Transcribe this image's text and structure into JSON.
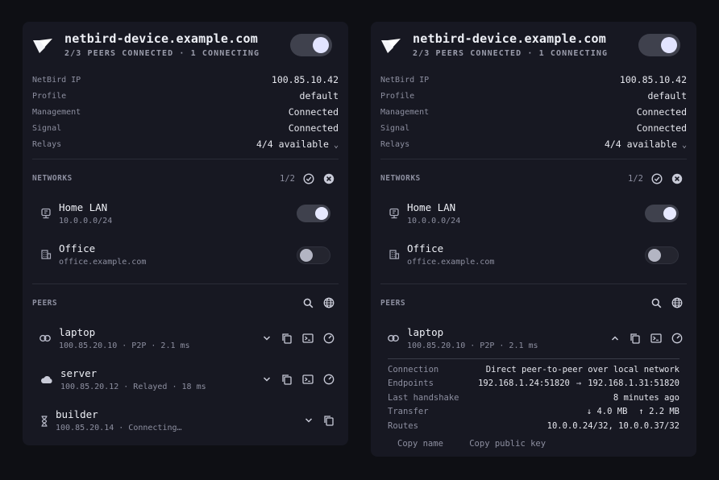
{
  "panels": [
    {
      "title": "netbird-device.example.com",
      "subtitle": "2/3 PEERS CONNECTED · 1 CONNECTING",
      "info": [
        {
          "label": "NetBird IP",
          "value": "100.85.10.42"
        },
        {
          "label": "Profile",
          "value": "default"
        },
        {
          "label": "Management",
          "value": "Connected"
        },
        {
          "label": "Signal",
          "value": "Connected"
        },
        {
          "label": "Relays",
          "value": "4/4 available"
        }
      ],
      "networks_title": "NETWORKS",
      "networks_count": "1/2",
      "networks": [
        {
          "name": "Home LAN",
          "sub": "10.0.0.0/24",
          "enabled": true,
          "icon": "router-icon"
        },
        {
          "name": "Office",
          "sub": "office.example.com",
          "enabled": false,
          "icon": "building-icon"
        }
      ],
      "peers_title": "PEERS",
      "peers": [
        {
          "name": "laptop",
          "sub": "100.85.20.10 · P2P · 2.1 ms",
          "icon": "link-icon"
        },
        {
          "name": "server",
          "sub": "100.85.20.12 · Relayed · 18 ms",
          "icon": "cloud-icon"
        },
        {
          "name": "builder",
          "sub": "100.85.20.14 · Connecting…",
          "icon": "hourglass-icon"
        }
      ]
    },
    {
      "title": "netbird-device.example.com",
      "subtitle": "2/3 PEERS CONNECTED · 1 CONNECTING",
      "info": [
        {
          "label": "NetBird IP",
          "value": "100.85.10.42"
        },
        {
          "label": "Profile",
          "value": "default"
        },
        {
          "label": "Management",
          "value": "Connected"
        },
        {
          "label": "Signal",
          "value": "Connected"
        },
        {
          "label": "Relays",
          "value": "4/4 available"
        }
      ],
      "networks_title": "NETWORKS",
      "networks_count": "1/2",
      "networks": [
        {
          "name": "Home LAN",
          "sub": "10.0.0.0/24",
          "enabled": true,
          "icon": "router-icon"
        },
        {
          "name": "Office",
          "sub": "office.example.com",
          "enabled": false,
          "icon": "building-icon"
        }
      ],
      "peers_title": "PEERS",
      "peers": [
        {
          "name": "laptop",
          "sub": "100.85.20.10 · P2P · 2.1 ms",
          "icon": "link-icon",
          "expanded": true
        }
      ],
      "peer_detail": {
        "connection_label": "Connection",
        "connection_value": "Direct peer-to-peer over local network",
        "endpoints_label": "Endpoints",
        "endpoint_local": "192.168.1.24:51820",
        "endpoint_arrow": "→",
        "endpoint_remote": "192.168.1.31:51820",
        "handshake_label": "Last handshake",
        "handshake_value": "8 minutes ago",
        "transfer_label": "Transfer",
        "transfer_down": "↓ 4.0 MB",
        "transfer_up": "↑ 2.2 MB",
        "routes_label": "Routes",
        "routes_value": "10.0.0.24/32, 10.0.0.37/32"
      },
      "copy_name": "Copy name",
      "copy_key": "Copy public key"
    }
  ],
  "colors": {
    "background": "#0e0f14",
    "panel": "#171822",
    "text": "#e6e7ee",
    "muted": "#8d8fa0"
  }
}
